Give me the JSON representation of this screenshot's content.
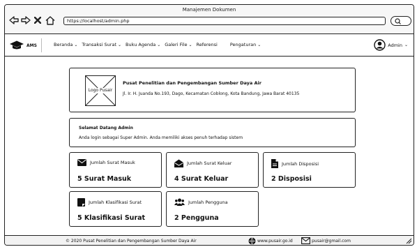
{
  "window": {
    "title": "Manajemen Dokumen"
  },
  "browser": {
    "url": "https://localhost/admin.php"
  },
  "brand": {
    "name": "AMS"
  },
  "nav": {
    "items": [
      {
        "label": "Beranda"
      },
      {
        "label": "Transaksi Surat"
      },
      {
        "label": "Buku Agenda"
      },
      {
        "label": "Galeri File"
      },
      {
        "label": "Referensi"
      },
      {
        "label": "Pengaturan"
      }
    ],
    "user": "Admin"
  },
  "org": {
    "logo_label": "Logo Pusair",
    "name": "Pusat Penelitian dan Pengembangan Sumber Daya Air",
    "address": "Jl. Ir. H. Juanda No.193, Dago, Kecamatan Coblong, Kota Bandung, Jawa Barat 40135"
  },
  "welcome": {
    "title": "Selamat Datang Admin",
    "text": "Anda login sebagai Super Admin. Anda memiliki akses penuh terhadap sistem"
  },
  "stats": [
    {
      "label": "Jumlah Surat Masuk",
      "value": "5 Surat Masuk",
      "icon": "envelope-icon"
    },
    {
      "label": "Jumlah Surat Keluar",
      "value": "4 Surat Keluar",
      "icon": "envelope-open-icon"
    },
    {
      "label": "Jumlah Disposisi",
      "value": "2 Disposisi",
      "icon": "file-icon"
    },
    {
      "label": "Jumlah Klasifikasi Surat",
      "value": "5 Klasifikasi Surat",
      "icon": "clipboard-icon"
    },
    {
      "label": "Jumlah Pengguna",
      "value": "2 Pengguna",
      "icon": "users-icon"
    }
  ],
  "footer": {
    "copyright": "© 2020 Pusat Penelitian dan Pengembangan Sumber Daya Air",
    "website": "www.pusair.go.id",
    "email": "pusair@gmail.com"
  }
}
